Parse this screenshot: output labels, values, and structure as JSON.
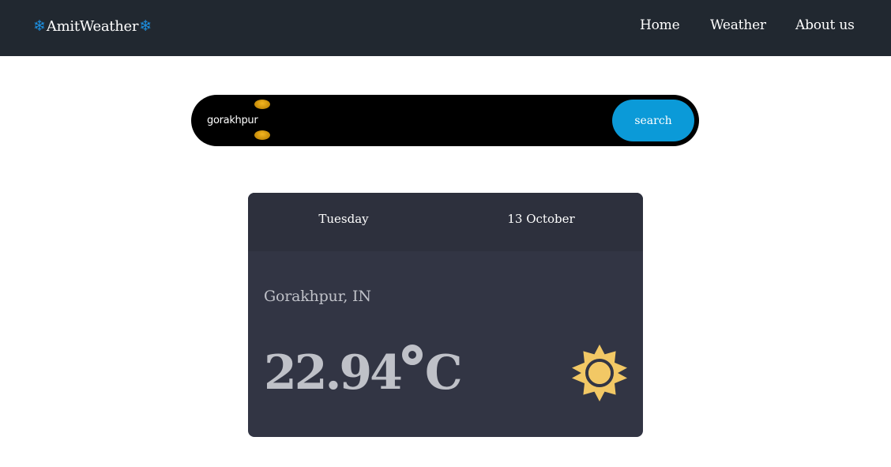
{
  "nav": {
    "brand": "AmitWeather",
    "brand_icon": "snowflake-icon",
    "brand_icon_color": "#1d8fe0",
    "links": [
      {
        "label": "Home"
      },
      {
        "label": "Weather"
      },
      {
        "label": "About us"
      }
    ]
  },
  "search": {
    "value": "gorakhpur",
    "button_label": "search",
    "button_color": "#0b9ad8"
  },
  "weather": {
    "day": "Tuesday",
    "date": "13 October",
    "location": "Gorakhpur, IN",
    "temperature": "22.94",
    "unit": "C",
    "icon": "sun-icon",
    "icon_color": "#f2c865"
  }
}
